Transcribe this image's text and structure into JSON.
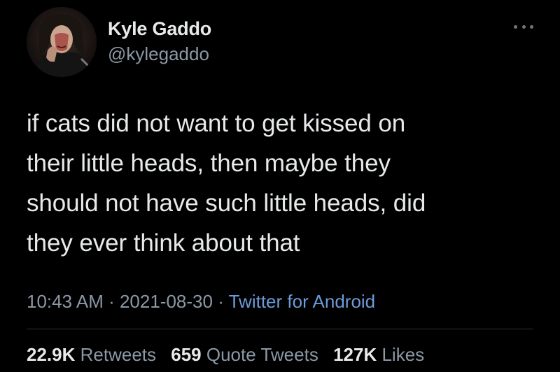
{
  "author": {
    "display_name": "Kyle Gaddo",
    "handle": "@kylegaddo"
  },
  "tweet": {
    "text_lines": [
      "if cats did not want to get kissed on",
      "their little heads, then maybe they",
      "should not have such little heads, did",
      "they ever think about that"
    ]
  },
  "meta": {
    "time": "10:43 AM",
    "sep1": " · ",
    "date": "2021-08-30",
    "sep2": " · ",
    "source": "Twitter for Android"
  },
  "stats": {
    "retweets_count": "22.9K",
    "retweets_label": "Retweets",
    "quotes_count": "659",
    "quotes_label": "Quote Tweets",
    "likes_count": "127K",
    "likes_label": "Likes"
  },
  "colors": {
    "background": "#000000",
    "text": "#e7e9ea",
    "secondary": "#8b98a5",
    "link": "#6b9bd8"
  },
  "icons": {
    "more": "more-horizontal-icon"
  }
}
